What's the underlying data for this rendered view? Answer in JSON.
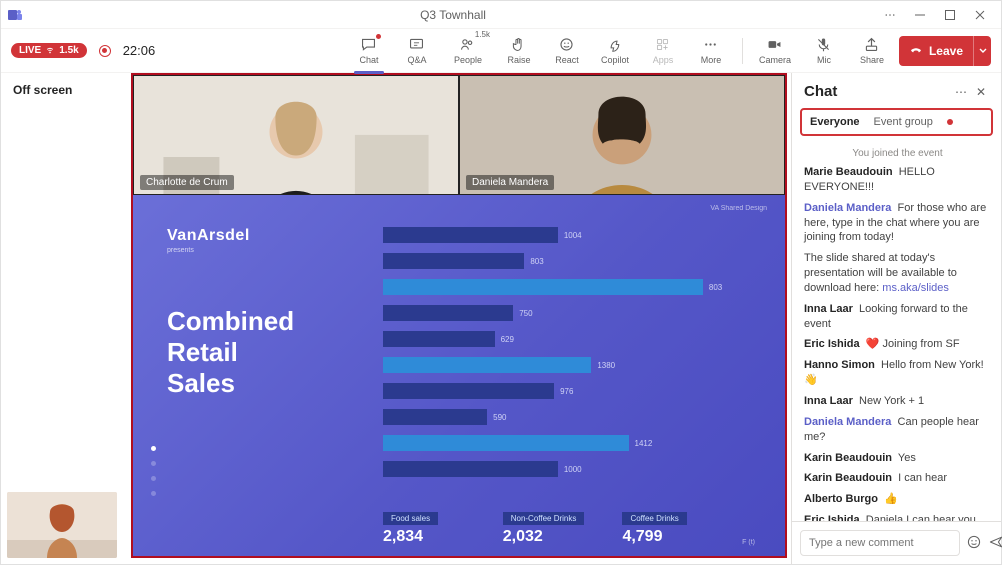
{
  "window": {
    "title": "Q3 Townhall"
  },
  "status": {
    "live_label": "LIVE",
    "viewers": "1.5k",
    "timer": "22:06"
  },
  "toolbar": {
    "chat": "Chat",
    "qa": "Q&A",
    "people": "People",
    "people_count": "1.5k",
    "raise": "Raise",
    "react": "React",
    "copilot": "Copilot",
    "apps": "Apps",
    "more": "More",
    "camera": "Camera",
    "mic": "Mic",
    "share": "Share",
    "leave": "Leave"
  },
  "left": {
    "offscreen": "Off screen"
  },
  "videos": [
    {
      "name": "Charlotte de Crum"
    },
    {
      "name": "Daniela Mandera"
    }
  ],
  "slide": {
    "brand": "VanArsdel",
    "brand_sub": "presents",
    "title_l1": "Combined",
    "title_l2": "Retail",
    "title_l3": "Sales",
    "topright": "VA Shared Design",
    "footer": [
      {
        "label": "Food sales",
        "value": "2,834"
      },
      {
        "label": "Non-Coffee Drinks",
        "value": "2,032"
      },
      {
        "label": "Coffee Drinks",
        "value": "4,799"
      }
    ],
    "footnote": "F (t)"
  },
  "chart_data": {
    "type": "bar",
    "orientation": "horizontal",
    "series": [
      {
        "name": "dark",
        "color": "#2b3a8f",
        "values": [
          1004,
          803,
          750,
          629,
          976,
          590,
          1000
        ]
      },
      {
        "name": "light",
        "color": "#2f8bd8",
        "values": [
          null,
          803,
          null,
          1380,
          null,
          1412,
          null
        ]
      }
    ],
    "labels": [
      "1004",
      "803",
      "803",
      "750",
      "629",
      "1380",
      "976",
      "590",
      "1412",
      "1000"
    ],
    "xlim": [
      0,
      1500
    ]
  },
  "chat": {
    "title": "Chat",
    "tabs": {
      "everyone": "Everyone",
      "group": "Event group"
    },
    "system": "You joined the event",
    "messages": [
      {
        "who": "Marie Beaudouin",
        "text": "HELLO EVERYONE!!!",
        "accent": false
      },
      {
        "who": "Daniela Mandera",
        "text": "For those who are here, type in the chat where you are joining from today!",
        "accent": true
      },
      {
        "who": "",
        "text": "The slide shared at today's presentation will be available to download here: ",
        "link": "ms.aka/slides",
        "plain": true
      },
      {
        "who": "Inna Laar",
        "text": "Looking forward to the event"
      },
      {
        "who": "Eric Ishida",
        "text": "❤️  Joining from SF"
      },
      {
        "who": "Hanno Simon",
        "text": "Hello from New York!   👋"
      },
      {
        "who": "Inna Laar",
        "text": "New York + 1"
      },
      {
        "who": "Daniela Mandera",
        "text": "Can people hear me?",
        "accent": true
      },
      {
        "who": "Karin Beaudouin",
        "text": "Yes"
      },
      {
        "who": "Karin Beaudouin",
        "text": "I can hear"
      },
      {
        "who": "Alberto Burgo",
        "text": "👍"
      },
      {
        "who": "Eric Ishida",
        "text": "Daniela I can hear you"
      }
    ],
    "compose_placeholder": "Type a new comment"
  }
}
